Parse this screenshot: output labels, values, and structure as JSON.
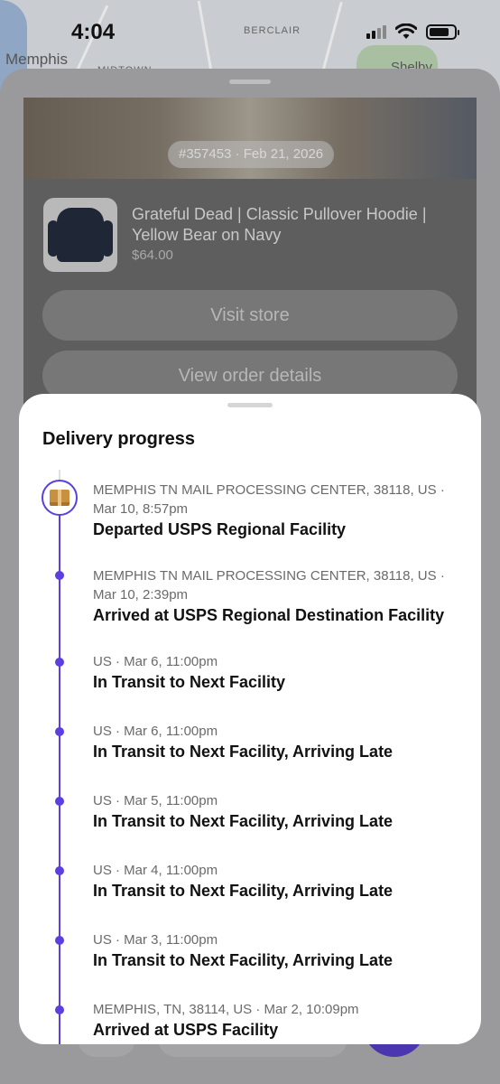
{
  "status_bar": {
    "time": "4:04"
  },
  "map": {
    "label_city": "Memphis",
    "label_area": "BERCLAIR",
    "label_small": "MIDTOWN",
    "label_right": "Shelby"
  },
  "order": {
    "pill": "#357453 · Feb 21, 2026",
    "product_title": "Grateful Dead | Classic Pullover Hoodie | Yellow Bear on Navy",
    "product_price": "$64.00",
    "visit_store": "Visit store",
    "view_details": "View order details"
  },
  "delivery": {
    "title": "Delivery progress",
    "events": [
      {
        "meta": "MEMPHIS TN MAIL PROCESSING CENTER, 38118, US · Mar 10, 8:57pm",
        "status": "Departed USPS Regional Facility"
      },
      {
        "meta": "MEMPHIS TN MAIL PROCESSING CENTER, 38118, US · Mar 10, 2:39pm",
        "status": "Arrived at USPS Regional Destination Facility"
      },
      {
        "meta": "US · Mar 6, 11:00pm",
        "status": "In Transit to Next Facility"
      },
      {
        "meta": "US · Mar 6, 11:00pm",
        "status": "In Transit to Next Facility, Arriving Late"
      },
      {
        "meta": "US · Mar 5, 11:00pm",
        "status": "In Transit to Next Facility, Arriving Late"
      },
      {
        "meta": "US · Mar 4, 11:00pm",
        "status": "In Transit to Next Facility, Arriving Late"
      },
      {
        "meta": "US · Mar 3, 11:00pm",
        "status": "In Transit to Next Facility, Arriving Late"
      },
      {
        "meta": "MEMPHIS, TN, 38114, US · Mar 2, 10:09pm",
        "status": "Arrived at USPS Facility"
      }
    ]
  },
  "colors": {
    "accent": "#5b3fe0",
    "overlay": "#8d8d8f"
  }
}
